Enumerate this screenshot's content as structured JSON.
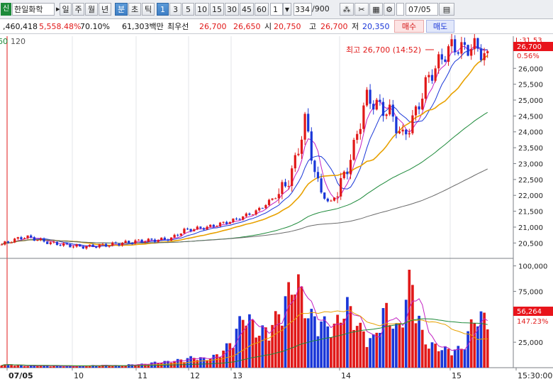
{
  "toolbar": {
    "stock_tag": "신",
    "stock_name": "한일화학",
    "periods": [
      "일",
      "주",
      "월",
      "년",
      "분",
      "초",
      "틱"
    ],
    "intervals": [
      "1",
      "3",
      "5",
      "10",
      "15",
      "30",
      "45",
      "60"
    ],
    "interval_select": "1",
    "count": "334",
    "count_total": "/900",
    "date": "07/05"
  },
  "info": {
    "volume": ",460,418",
    "vol_ratio": "5,558.48%",
    "turnover": "70.10%",
    "amount": "61,303백만",
    "ask_label": "최우선",
    "ask": "26,700",
    "bid": "26,650",
    "open_label": "시",
    "open": "20,750",
    "high_label": "고",
    "high": "26,700",
    "low_label": "저",
    "low": "20,350",
    "buy": "매수",
    "sell": "매도"
  },
  "chart_header": {
    "ma_left": "60",
    "ma_label": "120"
  },
  "price_panel": {
    "high_annotation": "최고 26,700 (14:52)",
    "top_label": "L:31.53",
    "current_price": "26,700",
    "change_pct": "0.56%",
    "y_ticks": [
      "26,000",
      "25,500",
      "25,000",
      "24,500",
      "24,000",
      "23,500",
      "23,000",
      "22,500",
      "22,000",
      "21,500",
      "21,000",
      "20,500"
    ]
  },
  "volume_panel": {
    "y_ticks": [
      "100,000",
      "75,000",
      "25,000"
    ],
    "current_volume": "56,264",
    "vol_pct": "147.23%"
  },
  "x_axis": {
    "labels": [
      "07/05",
      "10",
      "11",
      "12",
      "13",
      "14",
      "15",
      "15:30:00"
    ]
  },
  "chart_data": {
    "type": "candlestick",
    "price_ylim": [
      20150,
      26900
    ],
    "volume_ylim": [
      0,
      106000
    ],
    "price_samples": [
      20450,
      20600,
      20700,
      20600,
      20500,
      20450,
      20400,
      20380,
      20420,
      20450,
      20500,
      20550,
      20580,
      20600,
      20650,
      20900,
      20950,
      21000,
      21100,
      21200,
      21350,
      21500,
      21800,
      22100,
      22800,
      24400,
      22300,
      21700,
      22400,
      23500,
      25100,
      24800,
      24600,
      23800,
      24500,
      25600,
      26200,
      26700,
      26600,
      26700,
      26300
    ],
    "volume_samples": [
      4000,
      3000,
      2000,
      2500,
      2000,
      1500,
      2000,
      2500,
      3000,
      2000,
      3500,
      4000,
      6000,
      7000,
      9000,
      12000,
      10000,
      15000,
      30000,
      64000,
      40000,
      45000,
      70000,
      104000,
      60000,
      52000,
      46000,
      72000,
      45000,
      30000,
      68000,
      40000,
      104000,
      30000,
      24000,
      20000,
      22000,
      58000,
      56264
    ]
  }
}
